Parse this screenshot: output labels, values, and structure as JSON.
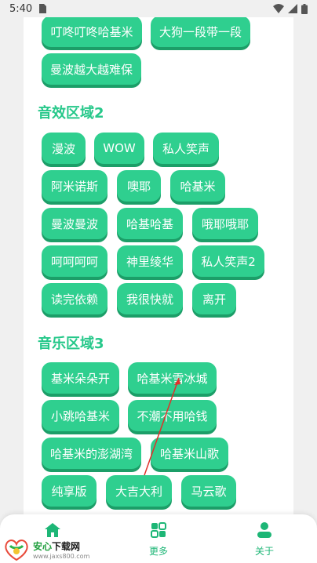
{
  "status_bar": {
    "time": "5:40"
  },
  "section1": {
    "buttons": [
      "叮咚叮咚哈基米",
      "大狗一段带一段",
      "曼波越大越难保"
    ]
  },
  "section2": {
    "title": "音效区域2",
    "buttons": [
      "漫波",
      "WOW",
      "私人笑声",
      "阿米诺斯",
      "噢耶",
      "哈基米",
      "曼波曼波",
      "哈基哈基",
      "哦耶哦耶",
      "呵呵呵呵",
      "神里绫华",
      "私人笑声2",
      "读完依赖",
      "我很快就",
      "离开"
    ]
  },
  "section3": {
    "title": "音乐区域3",
    "buttons": [
      "基米朵朵开",
      "哈基米雪冰城",
      "小跳哈基米",
      "不潮不用哈钱",
      "哈基米的澎湖湾",
      "哈基米山歌",
      "纯享版",
      "大吉大利",
      "马云歌"
    ]
  },
  "bottom_nav": {
    "items": [
      {
        "label": "",
        "icon": "home-icon"
      },
      {
        "label": "更多",
        "icon": "more-icon"
      },
      {
        "label": "关于",
        "icon": "about-icon"
      }
    ]
  },
  "watermark": {
    "brand_green": "安心",
    "brand_dark": "下载网",
    "url": "www.jaxs800.com"
  },
  "colors": {
    "button": "#2fcf8f",
    "button_shadow": "#1c9e68",
    "title": "#26c88a",
    "nav_active": "#1db676"
  }
}
